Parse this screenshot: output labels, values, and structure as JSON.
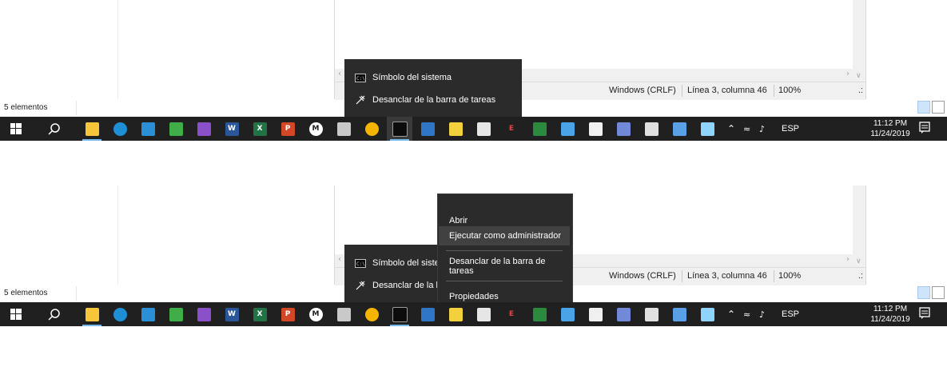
{
  "explorer": {
    "status_text": "5 elementos"
  },
  "notepad": {
    "line_ending": "Windows (CRLF)",
    "position": "Línea 3, columna 46",
    "zoom": "100%"
  },
  "jumplist": {
    "items": [
      {
        "label": "Símbolo del sistema",
        "icon": "command-prompt-icon"
      },
      {
        "label": "Desanclar de la barra de tareas",
        "icon": "unpin-icon"
      }
    ],
    "items_truncated": [
      {
        "label": "Símbolo del sister",
        "icon": "command-prompt-icon"
      },
      {
        "label": "Desanclar de la barra de tareas",
        "icon": "unpin-icon"
      }
    ]
  },
  "context_menu": {
    "items": [
      {
        "label": "Abrir"
      },
      {
        "label": "Ejecutar como administrador"
      },
      {
        "label": "Desanclar de la barra de tareas"
      },
      {
        "label": "Propiedades"
      }
    ]
  },
  "taskbar": {
    "apps": [
      {
        "name": "file-explorer-icon",
        "color": "#f8c53a"
      },
      {
        "name": "edge-icon",
        "color": "#1e8fd6"
      },
      {
        "name": "libreoffice-writer-icon",
        "color": "#2a8fd6"
      },
      {
        "name": "libreoffice-calc-icon",
        "color": "#3fae49"
      },
      {
        "name": "visual-studio-icon",
        "color": "#8a4fc9"
      },
      {
        "name": "word-icon",
        "color": "#2b579a"
      },
      {
        "name": "excel-icon",
        "color": "#217346"
      },
      {
        "name": "powerpoint-icon",
        "color": "#d24726"
      },
      {
        "name": "mega-icon",
        "color": "#ffffff"
      },
      {
        "name": "archive-icon",
        "color": "#c9c9c9"
      },
      {
        "name": "chrome-icon",
        "color": "#f4b400"
      },
      {
        "name": "command-prompt-icon",
        "color": "#9a9a9a"
      },
      {
        "name": "matlab-icon",
        "color": "#2f77c6"
      },
      {
        "name": "python-idle-icon",
        "color": "#f2d13c"
      },
      {
        "name": "microphone-app-icon",
        "color": "#e6e6e6"
      },
      {
        "name": "latex-icon",
        "color": "#d44"
      },
      {
        "name": "spreadsheet-green-icon",
        "color": "#2b8a3e"
      },
      {
        "name": "3d-box-icon",
        "color": "#4aa3e6"
      },
      {
        "name": "graph-app-icon",
        "color": "#f0f0f0"
      },
      {
        "name": "discord-icon",
        "color": "#7289da"
      },
      {
        "name": "app-red-icon",
        "color": "#e0e0e0"
      },
      {
        "name": "app-blue-icon",
        "color": "#5aa0e6"
      },
      {
        "name": "app-pen-icon",
        "color": "#8fd3ff"
      }
    ],
    "tray": {
      "language": "ESP",
      "time": "11:12 PM",
      "date": "11/24/2019"
    }
  },
  "colors": {
    "taskbar": "#202020",
    "menu_bg": "#2b2b2b",
    "menu_hover": "#414141",
    "accent": "#76b9ed"
  }
}
